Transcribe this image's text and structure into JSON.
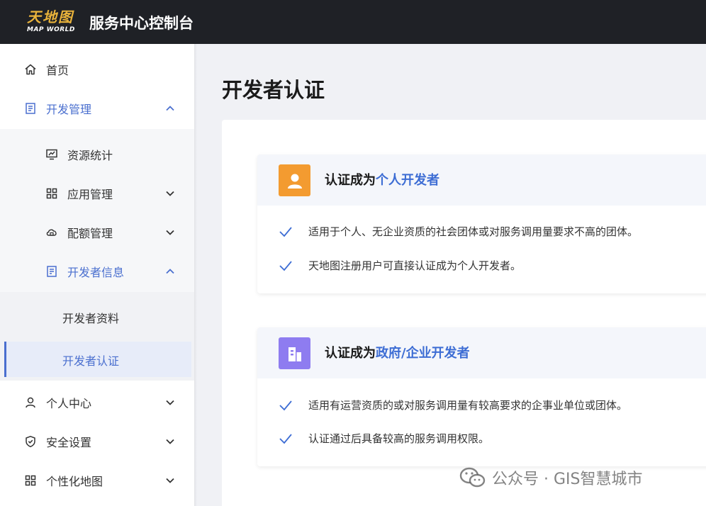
{
  "header": {
    "logo_cn": "天地图",
    "logo_en": "MAP WORLD",
    "title": "服务中心控制台"
  },
  "sidebar": {
    "home": "首页",
    "dev_manage": "开发管理",
    "resource_stats": "资源统计",
    "app_manage": "应用管理",
    "quota_manage": "配额管理",
    "dev_info": "开发者信息",
    "dev_profile": "开发者资料",
    "dev_cert": "开发者认证",
    "personal_center": "个人中心",
    "security": "安全设置",
    "custom_map": "个性化地图"
  },
  "main": {
    "page_title": "开发者认证",
    "personal": {
      "title_prefix": "认证成为",
      "title_highlight": "个人开发者",
      "bullets": [
        "适用于个人、无企业资质的社会团体或对服务调用量要求不高的团体。",
        "天地图注册用户可直接认证成为个人开发者。"
      ]
    },
    "enterprise": {
      "title_prefix": "认证成为",
      "title_highlight": "政府/企业开发者",
      "bullets": [
        "适用有运营资质的或对服务调用量有较高要求的企事业单位或团体。",
        "认证通过后具备较高的服务调用权限。"
      ]
    }
  },
  "watermark": "公众号 · GIS智慧城市",
  "colors": {
    "accent": "#4a6fcf",
    "highlight": "#3d6dd4",
    "personal_icon": "#f39b30",
    "enterprise_icon": "#8e7cf0",
    "header_bg": "#1f2126"
  }
}
